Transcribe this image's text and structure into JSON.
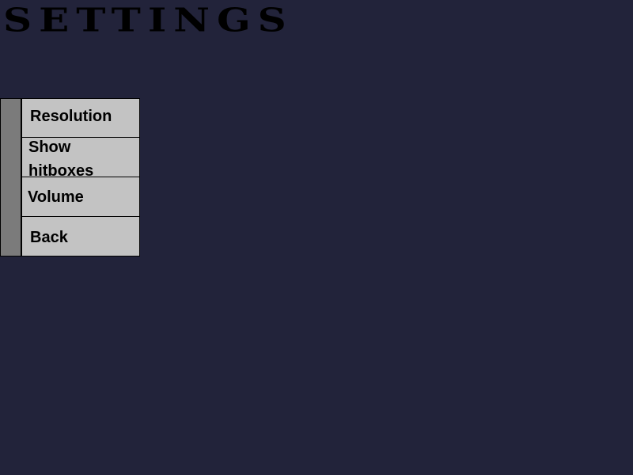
{
  "screen": {
    "title": "SETTINGS",
    "background_color": "#22233a"
  },
  "menu": {
    "strip_color": "#7b7b7b",
    "button_color": "#c3c3c3",
    "items": [
      {
        "label": "Resolution"
      },
      {
        "label": "Show hitboxes"
      },
      {
        "label": "Volume"
      },
      {
        "label": "Back"
      }
    ]
  }
}
